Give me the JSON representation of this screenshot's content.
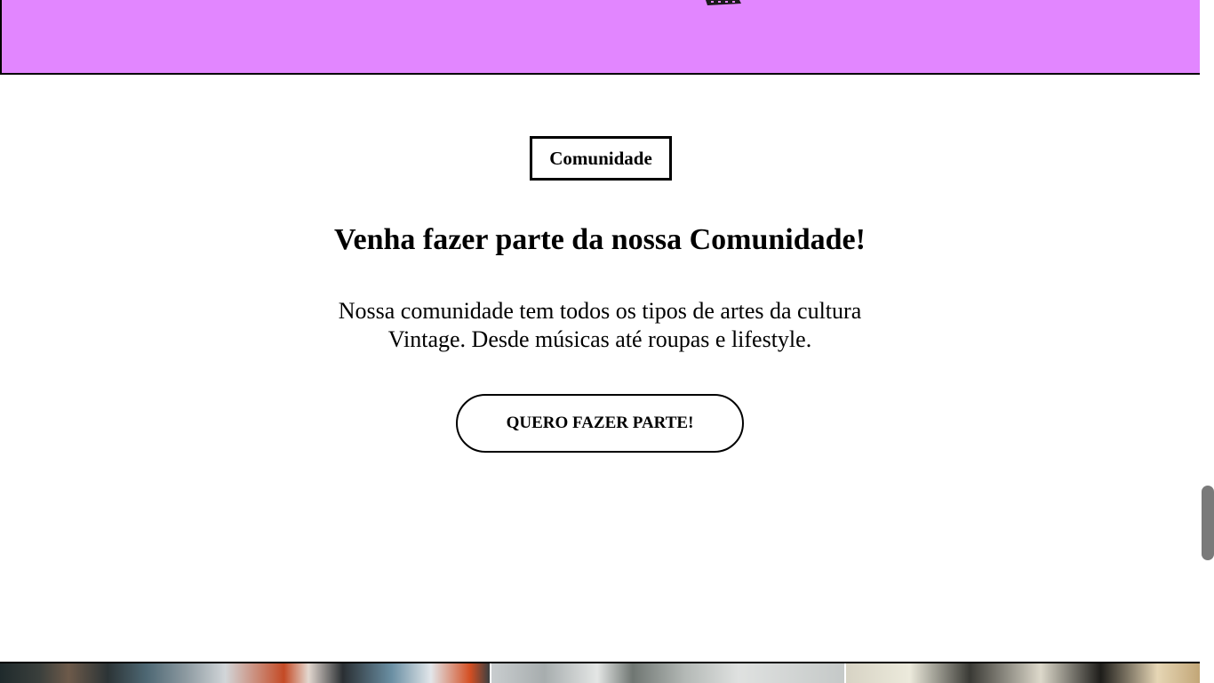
{
  "colors": {
    "banner_background": "#e286ff",
    "page_background": "#ffffff",
    "text": "#000000",
    "scrollbar_thumb": "#7a7a7a"
  },
  "community": {
    "tag_label": "Comunidade",
    "title": "Venha fazer parte da nossa Comunidade!",
    "description": "Nossa comunidade tem todos os tipos de artes da cultura Vintage. Desde músicas até roupas e lifestyle.",
    "cta_label": "QUERO FAZER PARTE!"
  },
  "banner": {
    "art_icon": "film-strip-icon"
  },
  "gallery": {
    "images": [
      "vintage-shop-photo",
      "plant-photo",
      "floral-decor-photo"
    ]
  }
}
